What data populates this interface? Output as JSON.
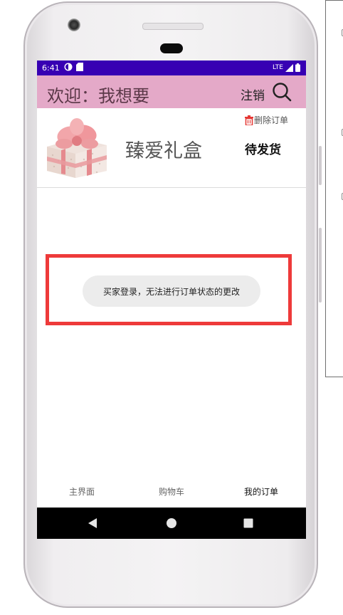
{
  "status_bar": {
    "time": "6:41",
    "network": "LTE"
  },
  "app_bar": {
    "title": "欢迎：我想要",
    "logout_label": "注销"
  },
  "order": {
    "delete_label": "删除订单",
    "product_name": "臻爱礼盒",
    "status": "待发货"
  },
  "toast": {
    "message": "买家登录，无法进行订单状态的更改"
  },
  "bottom_nav": {
    "items": [
      {
        "label": "主界面"
      },
      {
        "label": "购物车"
      },
      {
        "label": "我的订单"
      }
    ],
    "active_index": 2
  },
  "colors": {
    "status_bar": "#3700b3",
    "app_bar": "#e4a9c8",
    "highlight": "#ee3a3a",
    "delete_icon": "#e53935"
  },
  "icons": {
    "search": "search-icon",
    "delete": "trash-icon",
    "back": "back-triangle-icon",
    "home": "home-circle-icon",
    "recents": "recents-square-icon"
  }
}
